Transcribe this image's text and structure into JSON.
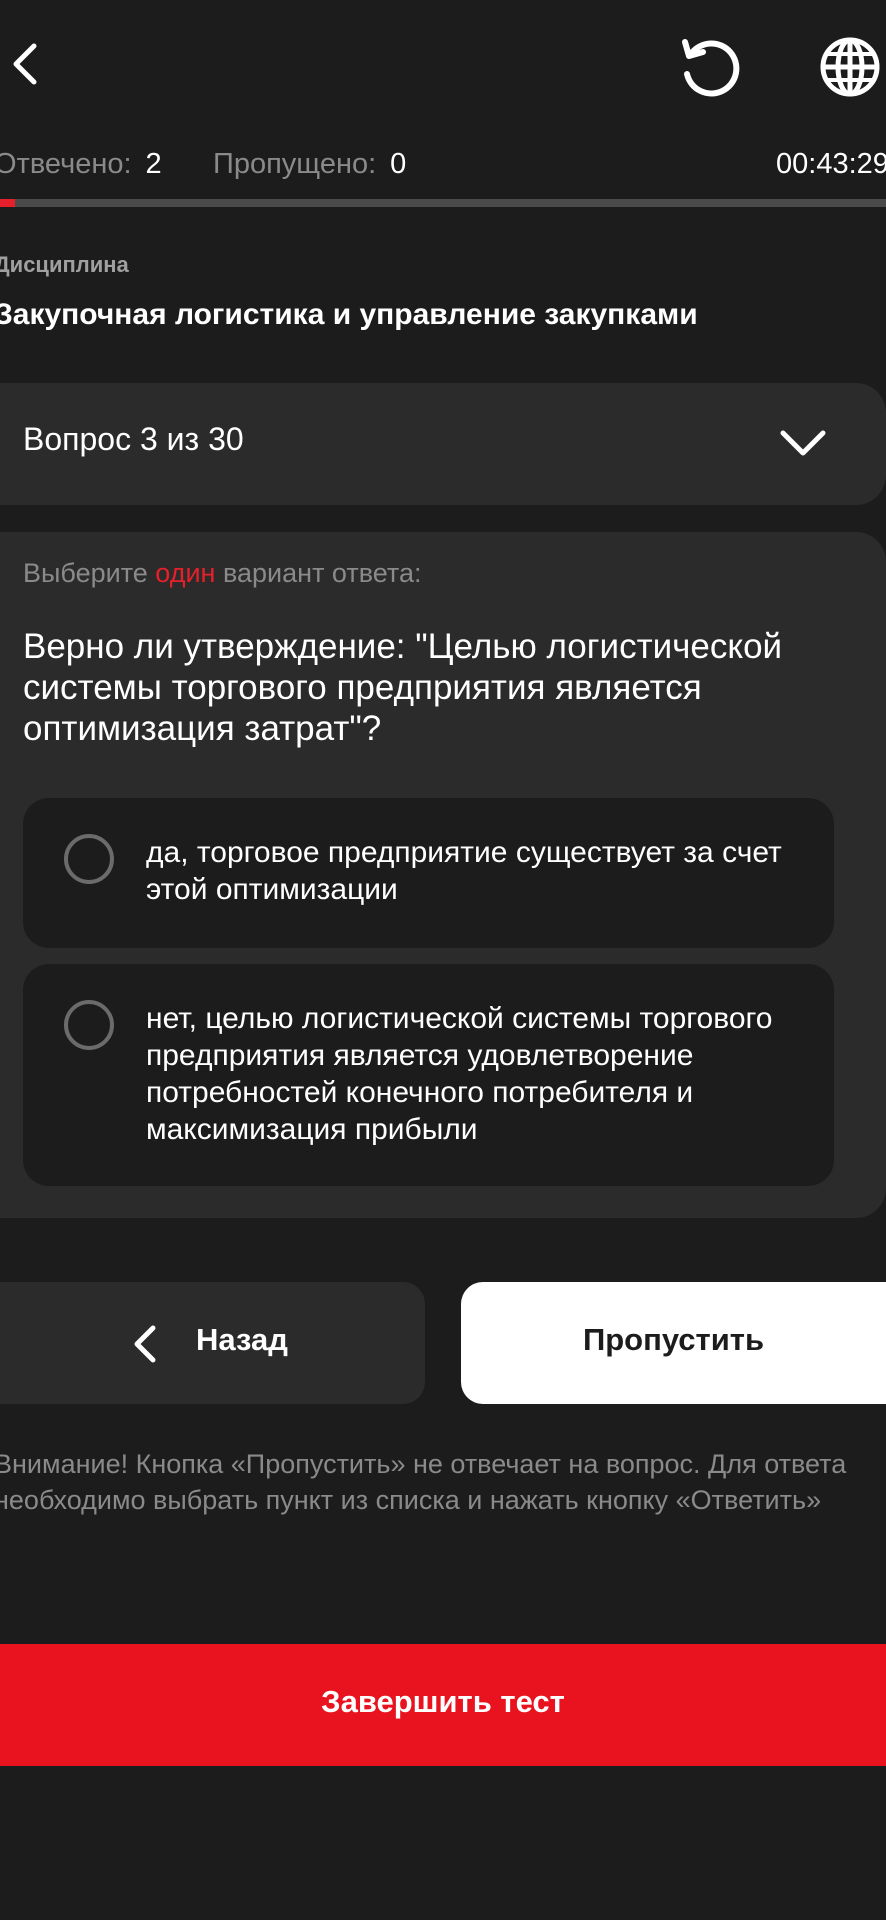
{
  "header": {
    "back_icon": "chevron-left-icon",
    "reset_icon": "reset-icon",
    "language_icon": "globe-icon"
  },
  "stats": {
    "answered_label": "Отвечено:",
    "answered_value": "2",
    "skipped_label": "Пропущено:",
    "skipped_value": "0",
    "timer": "00:43:29"
  },
  "progress": {
    "fraction": 0.0167,
    "accent_color": "#e5202a"
  },
  "discipline": {
    "label": "Дисциплина",
    "title": "Закупочная логистика и управление закупками"
  },
  "question_selector": {
    "label": "Вопрос 3 из 30",
    "icon": "chevron-down-icon"
  },
  "question": {
    "instruction_prefix": "Выберите",
    "instruction_accent": "один",
    "instruction_suffix": "вариант ответа:",
    "text": "Верно ли утверждение: \"Целью логистической системы торгового предприятия является оптимизация затрат\"?",
    "options": [
      {
        "label": "да, торговое предприятие существует за счет этой оптимизации"
      },
      {
        "label": "нет, целью логистической системы торгового предприятия является удовлетворение потребностей конечного потребителя и максимизация прибыли"
      }
    ]
  },
  "buttons": {
    "back_label": "Назад",
    "skip_label": "Пропустить",
    "finish_label": "Завершить тест"
  },
  "notice": "Внимание! Кнопка «Пропустить» не отвечает на вопрос. Для ответа необходимо выбрать пункт из списка и нажать кнопку «Ответить»",
  "colors": {
    "background": "#1c1c1c",
    "card": "#2b2b2b",
    "accent": "#e8131f"
  }
}
